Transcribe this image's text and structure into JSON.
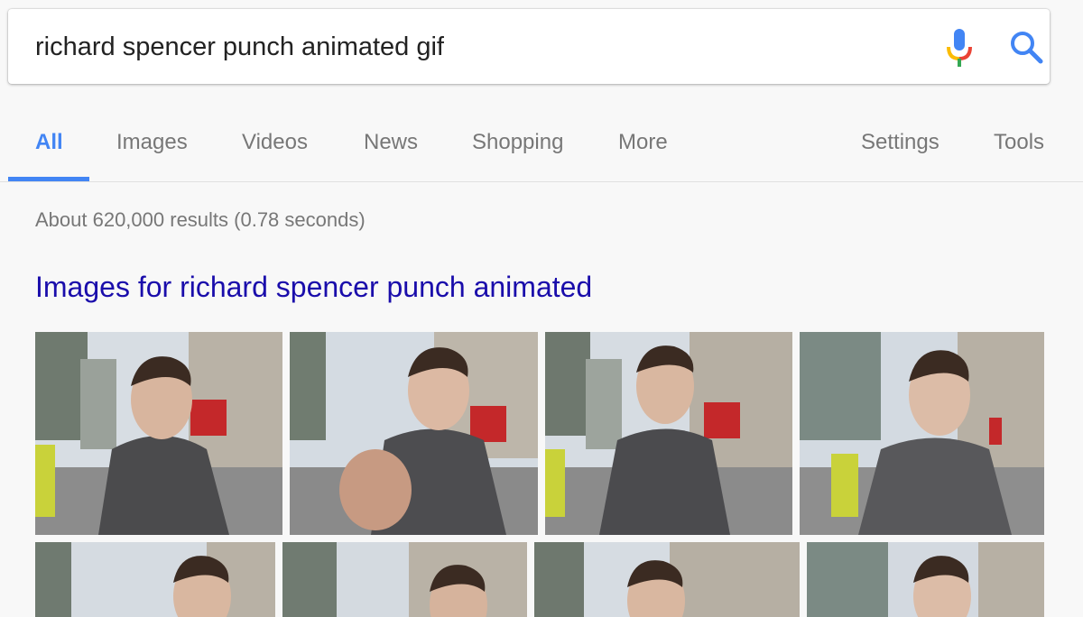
{
  "search": {
    "query": "richard spencer punch animated gif"
  },
  "tabs": {
    "all": "All",
    "images": "Images",
    "videos": "Videos",
    "news": "News",
    "shopping": "Shopping",
    "more": "More",
    "settings": "Settings",
    "tools": "Tools"
  },
  "results": {
    "stats": "About 620,000 results (0.78 seconds)",
    "images_heading": "Images for richard spencer punch animated"
  },
  "colors": {
    "accent": "#4285f4",
    "link": "#1a0dab",
    "muted": "#777777"
  },
  "icons": [
    "microphone-icon",
    "search-icon"
  ]
}
